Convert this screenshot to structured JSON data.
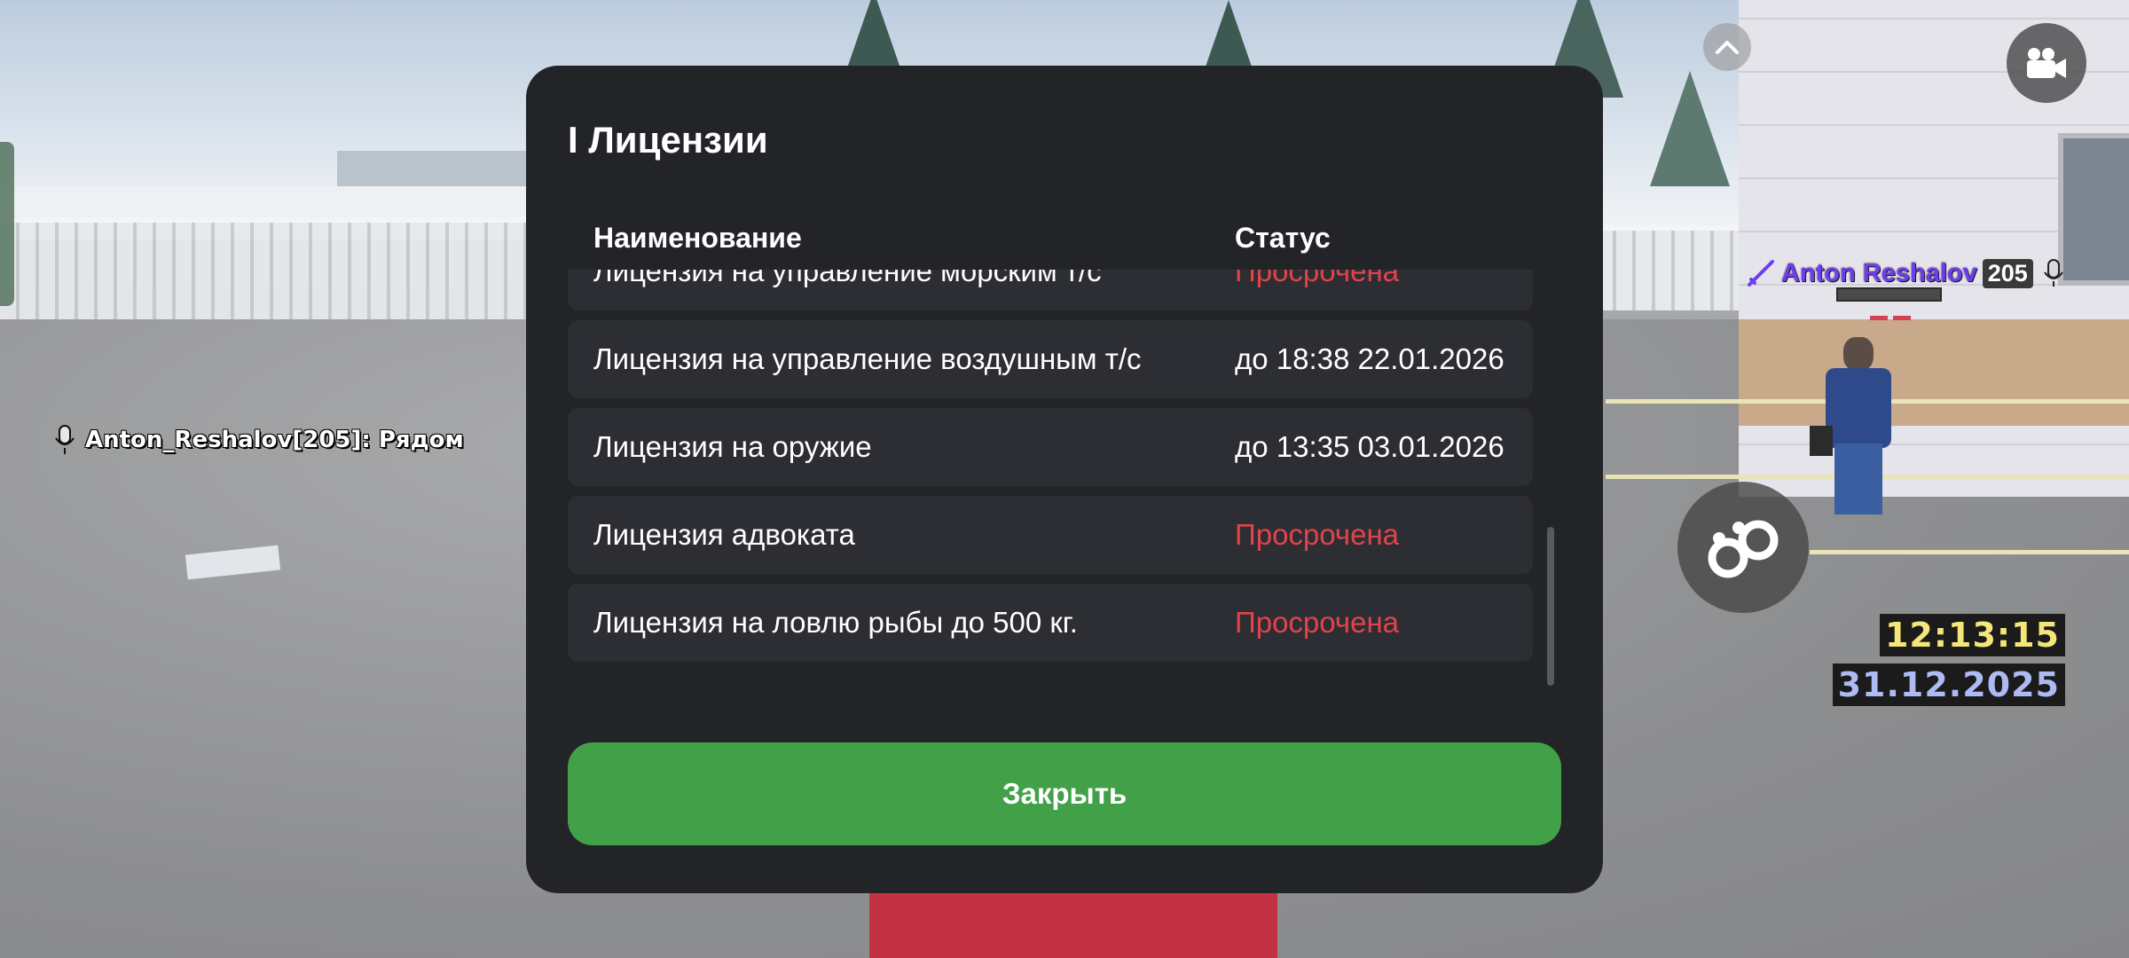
{
  "modal": {
    "title": "I Лицензии",
    "columns": {
      "name": "Наименование",
      "status": "Статус"
    },
    "rows": [
      {
        "name": "Лицензия на управление морским т/с",
        "status": "Просрочена",
        "state": "expired"
      },
      {
        "name": "Лицензия на управление воздушным т/с",
        "status": "до 18:38 22.01.2026",
        "state": "valid"
      },
      {
        "name": "Лицензия на оружие",
        "status": "до 13:35 03.01.2026",
        "state": "valid"
      },
      {
        "name": "Лицензия адвоката",
        "status": "Просрочена",
        "state": "expired"
      },
      {
        "name": "Лицензия на ловлю рыбы до 500 кг.",
        "status": "Просрочена",
        "state": "expired"
      }
    ],
    "close_label": "Закрыть",
    "colors": {
      "expired": "#e2434b",
      "valid": "#ffffff",
      "close_button": "#42a148",
      "panel": "#232428",
      "row": "#2d2e33"
    }
  },
  "hud": {
    "chat_line": "Anton_Reshalov[205]: Рядом",
    "player_tag": {
      "name": "Anton Reshalov",
      "id": "205"
    },
    "clock": {
      "time": "12:13:15",
      "date": "31.12.2025"
    },
    "buttons": {
      "up": "chevron-up-icon",
      "camera": "video-camera-icon",
      "cuffs": "handcuffs-icon"
    }
  }
}
